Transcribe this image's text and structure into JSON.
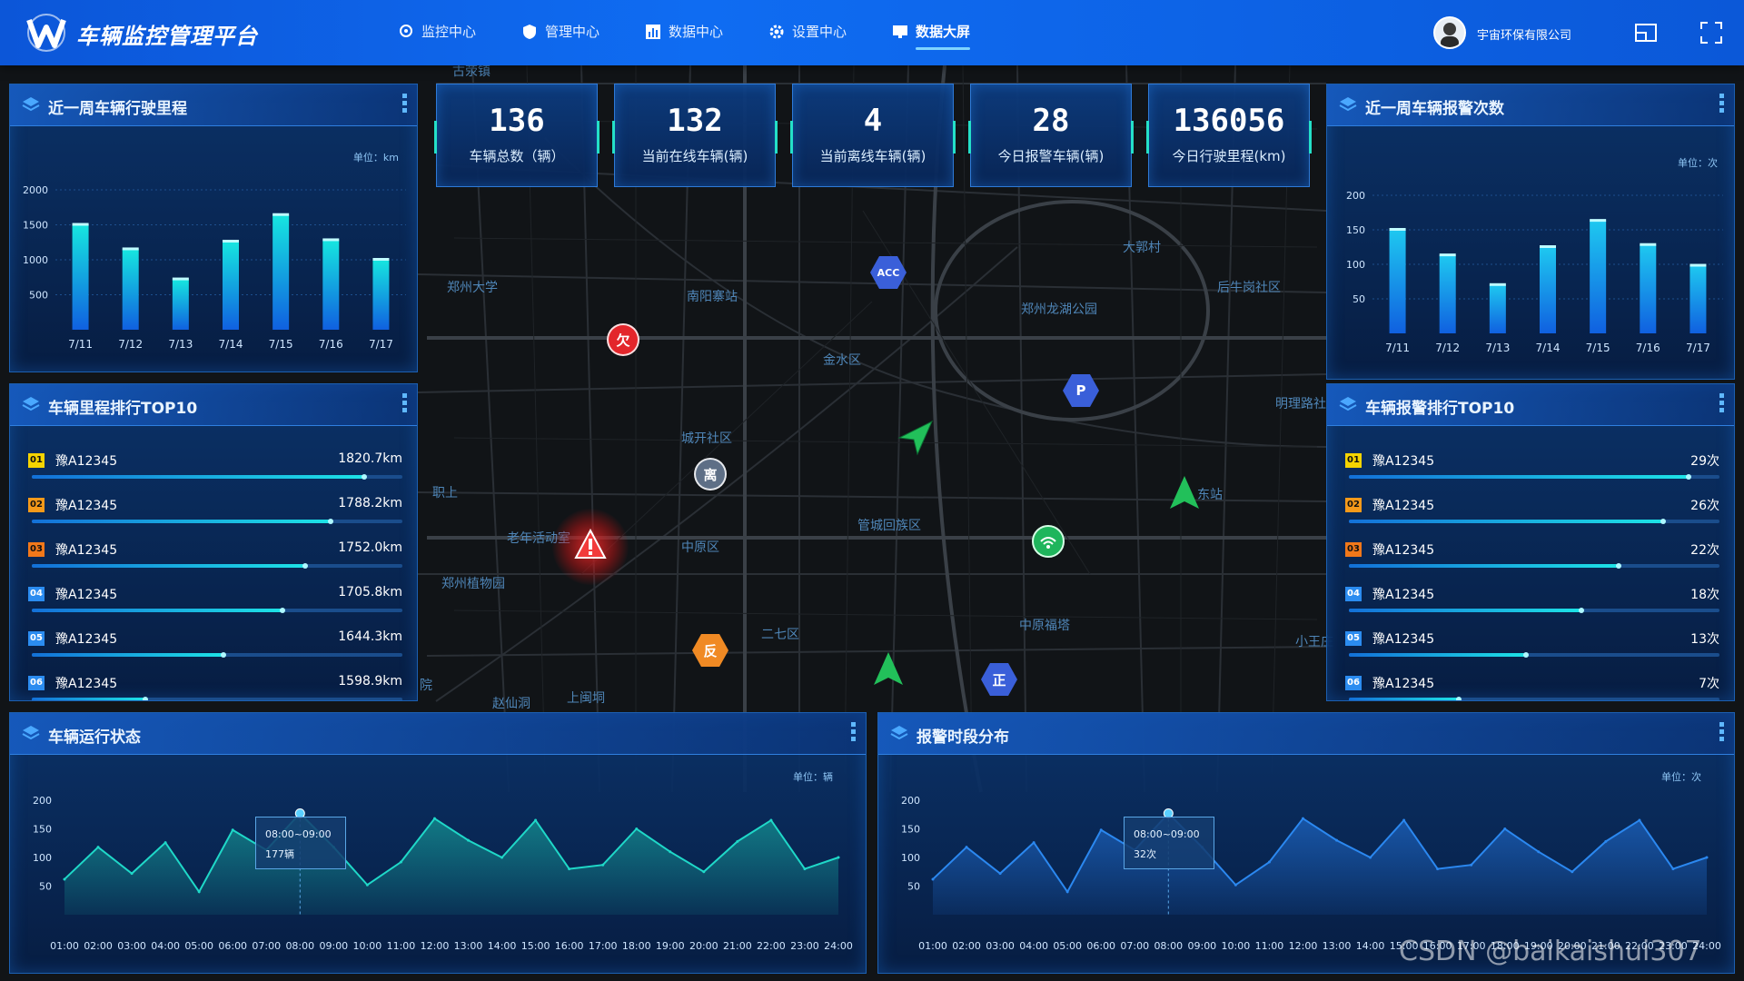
{
  "app": {
    "title": "车辆监控管理平台",
    "company": "宇宙环保有限公司"
  },
  "nav": [
    {
      "label": "监控中心",
      "icon": "location-icon"
    },
    {
      "label": "管理中心",
      "icon": "shield-icon"
    },
    {
      "label": "数据中心",
      "icon": "bar-chart-icon"
    },
    {
      "label": "设置中心",
      "icon": "gear-icon"
    },
    {
      "label": "数据大屏",
      "icon": "monitor-icon",
      "active": true
    }
  ],
  "stats": [
    {
      "value": "136",
      "label": "车辆总数（辆）"
    },
    {
      "value": "132",
      "label": "当前在线车辆(辆)"
    },
    {
      "value": "4",
      "label": "当前离线车辆(辆)"
    },
    {
      "value": "28",
      "label": "今日报警车辆(辆)"
    },
    {
      "value": "136056",
      "label": "今日行驶里程(km)"
    }
  ],
  "panels": {
    "mileage_week": {
      "title": "近一周车辆行驶里程",
      "unit": "单位：km"
    },
    "alarm_week": {
      "title": "近一周车辆报警次数",
      "unit": "单位：次"
    },
    "mileage_top": {
      "title": "车辆里程排行TOP10"
    },
    "alarm_top": {
      "title": "车辆报警排行TOP10"
    },
    "run_status": {
      "title": "车辆运行状态",
      "unit": "单位：辆",
      "tooltip_time": "08:00~09:00",
      "tooltip_value": "177辆"
    },
    "alarm_time": {
      "title": "报警时段分布",
      "unit": "单位：次",
      "tooltip_time": "08:00~09:00",
      "tooltip_value": "32次"
    }
  },
  "mileage_rank": [
    {
      "no": "01",
      "plate": "豫A12345",
      "value": "1820.7km",
      "ratio": 0.9,
      "color": "#f5d400"
    },
    {
      "no": "02",
      "plate": "豫A12345",
      "value": "1788.2km",
      "ratio": 0.81,
      "color": "#f59a1a"
    },
    {
      "no": "03",
      "plate": "豫A12345",
      "value": "1752.0km",
      "ratio": 0.74,
      "color": "#f2781a"
    },
    {
      "no": "04",
      "plate": "豫A12345",
      "value": "1705.8km",
      "ratio": 0.68,
      "color": "#2b8cf0"
    },
    {
      "no": "05",
      "plate": "豫A12345",
      "value": "1644.3km",
      "ratio": 0.52,
      "color": "#2b8cf0"
    },
    {
      "no": "06",
      "plate": "豫A12345",
      "value": "1598.9km",
      "ratio": 0.31,
      "color": "#2b8cf0"
    }
  ],
  "alarm_rank": [
    {
      "no": "01",
      "plate": "豫A12345",
      "value": "29次",
      "ratio": 0.92,
      "color": "#f5d400"
    },
    {
      "no": "02",
      "plate": "豫A12345",
      "value": "26次",
      "ratio": 0.85,
      "color": "#f59a1a"
    },
    {
      "no": "03",
      "plate": "豫A12345",
      "value": "22次",
      "ratio": 0.73,
      "color": "#f2781a"
    },
    {
      "no": "04",
      "plate": "豫A12345",
      "value": "18次",
      "ratio": 0.63,
      "color": "#2b8cf0"
    },
    {
      "no": "05",
      "plate": "豫A12345",
      "value": "13次",
      "ratio": 0.48,
      "color": "#2b8cf0"
    },
    {
      "no": "06",
      "plate": "豫A12345",
      "value": "7次",
      "ratio": 0.3,
      "color": "#2b8cf0"
    }
  ],
  "map": {
    "labels": [
      "古荥镇",
      "郑州大学",
      "南阳寨站",
      "大郭村",
      "郑州龙湖公园",
      "后牛岗社区",
      "金水区",
      "城开社区",
      "职上",
      "老年活动室",
      "中原区",
      "郑州植物园",
      "管城回族区",
      "二七区",
      "中原福塔",
      "东站",
      "明理路社",
      "小王庄",
      "院",
      "赵仙洞",
      "上闽垌"
    ],
    "markers": [
      {
        "type": "circle",
        "text": "欠",
        "color": "#e3262b"
      },
      {
        "type": "hex",
        "text": "ACC",
        "color": "#3a5fd9"
      },
      {
        "type": "hex",
        "text": "P",
        "color": "#3a5fd9"
      },
      {
        "type": "circle",
        "text": "离",
        "color": "#5e6f86"
      },
      {
        "type": "hex",
        "text": "反",
        "color": "#f08a24"
      },
      {
        "type": "hex",
        "text": "正",
        "color": "#3a5fd9"
      }
    ]
  },
  "chart_data": [
    {
      "type": "bar",
      "title": "近一周车辆行驶里程",
      "categories": [
        "7/11",
        "7/12",
        "7/13",
        "7/14",
        "7/15",
        "7/16",
        "7/17"
      ],
      "values": [
        1500,
        1150,
        720,
        1260,
        1640,
        1280,
        1000
      ],
      "ylim": [
        0,
        2000
      ],
      "yticks": [
        500,
        1000,
        1500,
        2000
      ],
      "colors": {
        "top": "#16e6e0",
        "bottom": "#1060e0"
      }
    },
    {
      "type": "bar",
      "title": "近一周车辆报警次数",
      "categories": [
        "7/11",
        "7/12",
        "7/13",
        "7/14",
        "7/15",
        "7/16",
        "7/17"
      ],
      "values": [
        150,
        113,
        70,
        125,
        163,
        128,
        98
      ],
      "ylim": [
        0,
        200
      ],
      "yticks": [
        50,
        100,
        150,
        200
      ],
      "colors": {
        "top": "#1ec8f0",
        "bottom": "#1060e0"
      }
    },
    {
      "type": "area",
      "title": "车辆运行状态",
      "categories": [
        "01:00",
        "02:00",
        "03:00",
        "04:00",
        "05:00",
        "06:00",
        "07:00",
        "08:00",
        "09:00",
        "10:00",
        "11:00",
        "12:00",
        "13:00",
        "14:00",
        "15:00",
        "16:00",
        "17:00",
        "18:00",
        "19:00",
        "20:00",
        "21:00",
        "22:00",
        "23:00",
        "24:00"
      ],
      "values": [
        62,
        118,
        72,
        126,
        40,
        148,
        113,
        177,
        118,
        52,
        92,
        168,
        130,
        100,
        165,
        80,
        87,
        150,
        110,
        75,
        128,
        165,
        80,
        100
      ],
      "ylim": [
        0,
        200
      ],
      "yticks": [
        50,
        100,
        150,
        200
      ],
      "colors": {
        "line": "#1fd8c8",
        "fill": "#138b8e"
      }
    },
    {
      "type": "area",
      "title": "报警时段分布",
      "categories": [
        "01:00",
        "02:00",
        "03:00",
        "04:00",
        "05:00",
        "06:00",
        "07:00",
        "08:00",
        "09:00",
        "10:00",
        "11:00",
        "12:00",
        "13:00",
        "14:00",
        "15:00",
        "16:00",
        "17:00",
        "18:00",
        "19:00",
        "20:00",
        "21:00",
        "22:00",
        "23:00",
        "24:00"
      ],
      "values": [
        62,
        118,
        72,
        126,
        40,
        148,
        113,
        177,
        118,
        52,
        92,
        168,
        130,
        100,
        165,
        80,
        87,
        150,
        110,
        75,
        128,
        165,
        80,
        100
      ],
      "ylim": [
        0,
        200
      ],
      "yticks": [
        50,
        100,
        150,
        200
      ],
      "colors": {
        "line": "#2b88f0",
        "fill": "#1b5fb8"
      }
    }
  ],
  "watermark": "CSDN @baikaishui307"
}
